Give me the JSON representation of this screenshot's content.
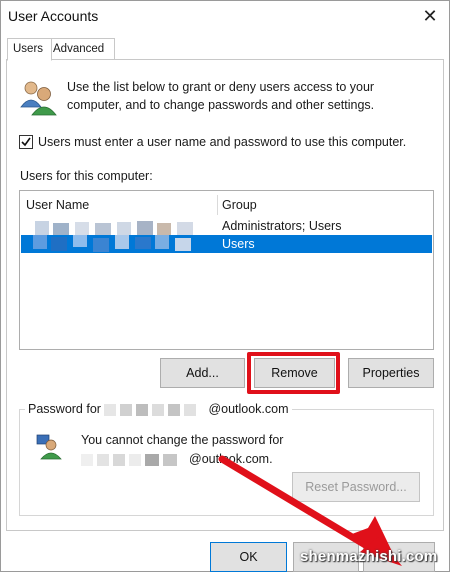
{
  "window": {
    "title": "User Accounts",
    "close_glyph": "✕"
  },
  "tabs": [
    {
      "label": "Users"
    },
    {
      "label": "Advanced"
    }
  ],
  "intro": {
    "text": "Use the list below to grant or deny users access to your computer, and to change passwords and other settings.",
    "icon": "users-icon"
  },
  "require_login": {
    "label": "Users must enter a user name and password to use this computer.",
    "checked": true
  },
  "users_list": {
    "label": "Users for this computer:",
    "columns": [
      "User Name",
      "Group"
    ],
    "rows": [
      {
        "group": "Administrators; Users",
        "selected": false
      },
      {
        "group": "Users",
        "selected": true
      }
    ]
  },
  "buttons": {
    "add": "Add...",
    "remove": "Remove",
    "properties": "Properties"
  },
  "password": {
    "title_prefix": "Password for",
    "title_suffix": "@outlook.com",
    "message_line1": "You cannot change the password for",
    "message_line2_suffix": "@outlook.com.",
    "reset_button": "Reset Password..."
  },
  "footer": {
    "ok": "OK"
  },
  "colors": {
    "selection": "#0078d7",
    "highlight": "#e0101a"
  },
  "watermark": "shenmazhishi.com"
}
